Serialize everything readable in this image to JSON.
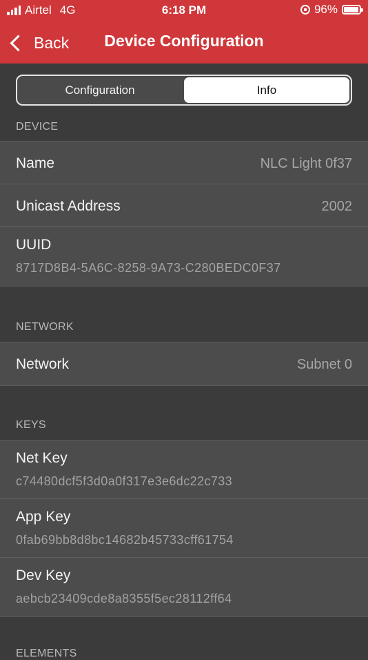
{
  "status_bar": {
    "carrier": "Airtel",
    "network": "4G",
    "time": "6:18 PM",
    "battery_percent_label": "96%",
    "battery_level": 0.96
  },
  "nav": {
    "back_label": "Back",
    "title": "Device Configuration"
  },
  "segments": [
    {
      "label": "Configuration",
      "selected": false
    },
    {
      "label": "Info",
      "selected": true
    }
  ],
  "device_section": {
    "header": "DEVICE",
    "name": {
      "label": "Name",
      "value": "NLC Light 0f37"
    },
    "unicast": {
      "label": "Unicast Address",
      "value": "2002"
    },
    "uuid": {
      "label": "UUID",
      "value": "8717D8B4-5A6C-8258-9A73-C280BEDC0F37"
    }
  },
  "network_section": {
    "header": "NETWORK",
    "network": {
      "label": "Network",
      "value": "Subnet 0"
    }
  },
  "keys_section": {
    "header": "KEYS",
    "net_key": {
      "label": "Net Key",
      "value": "c74480dcf5f3d0a0f317e3e6dc22c733"
    },
    "app_key": {
      "label": "App Key",
      "value": "0fab69bb8d8bc14682b45733cff61754"
    },
    "dev_key": {
      "label": "Dev Key",
      "value": "aebcb23409cde8a8355f5ec28112ff64"
    }
  },
  "elements_section": {
    "header": "ELEMENTS"
  },
  "colors": {
    "header_red": "#d0373a",
    "background": "#3b3b3b",
    "cell": "#4c4c4c"
  }
}
